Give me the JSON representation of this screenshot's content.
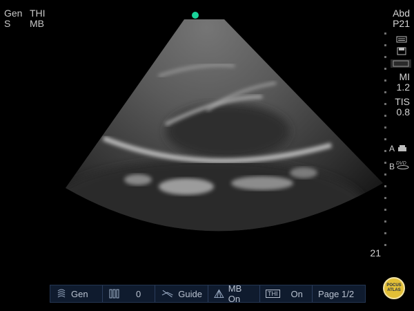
{
  "top_left": {
    "preset": "Gen",
    "mode": "S",
    "imaging": "THI",
    "filter": "MB"
  },
  "right_panel": {
    "exam": "Abd",
    "probe": "P21",
    "mi_label": "MI",
    "mi_value": "1.2",
    "tis_label": "TIS",
    "tis_value": "0.8",
    "icons": [
      "keyboard-icon",
      "save-icon",
      "screen-icon",
      "dvd-icon"
    ],
    "a_label": "A",
    "b_label": "B"
  },
  "depth_label": "21",
  "toolbar": {
    "items": [
      {
        "icon": "probe-icon",
        "label": "Gen"
      },
      {
        "icon": "bars-icon",
        "label": "0"
      },
      {
        "icon": "guide-off-icon",
        "label": "Guide"
      },
      {
        "icon": "multibeam-icon",
        "label": "MB On"
      },
      {
        "icon": "thi-icon",
        "icon_text": "THI",
        "label": "On"
      },
      {
        "label": "Page 1/2"
      }
    ]
  },
  "logo": {
    "line1": "POCUS",
    "line2": "ATLAS"
  },
  "colors": {
    "orientation_dot": "#19d39a",
    "toolbar_bg": "#0f1b2e"
  }
}
